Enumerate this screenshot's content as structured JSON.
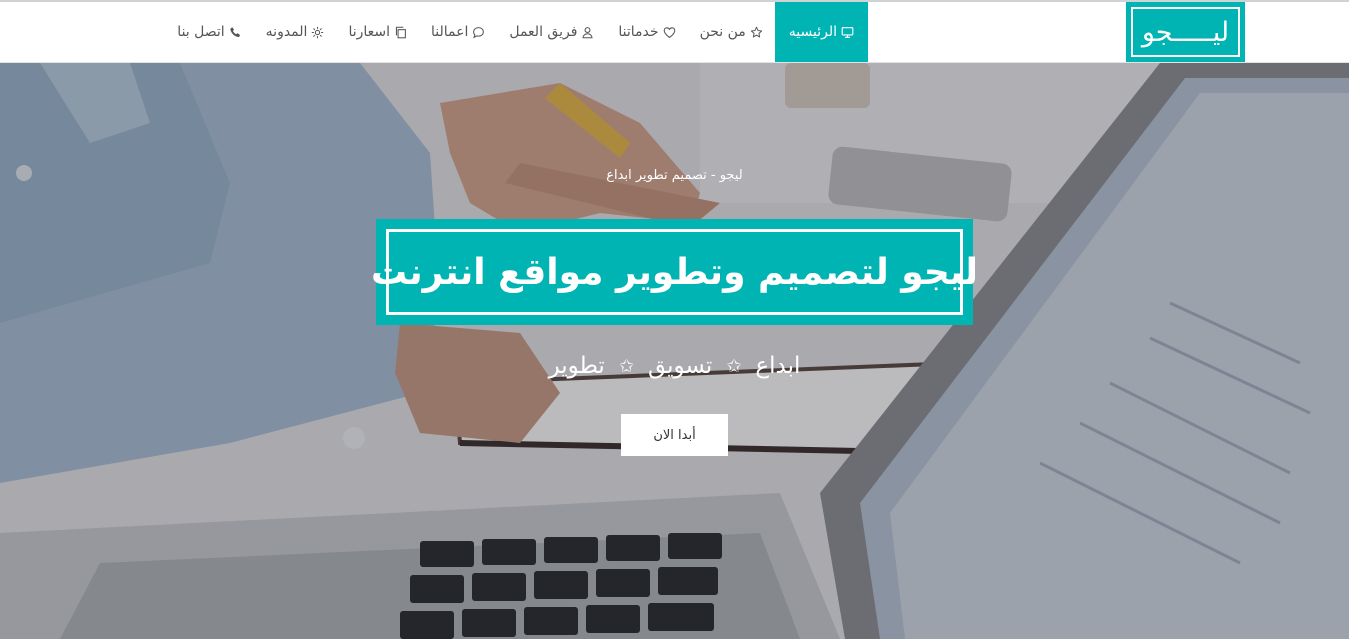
{
  "brand": {
    "logo_text": "ليـــــجو",
    "accent_color": "#00b4b4"
  },
  "nav": {
    "items": [
      {
        "label": "الرئيسيه",
        "icon": "monitor-icon",
        "active": true
      },
      {
        "label": "من نحن",
        "icon": "star-icon",
        "active": false
      },
      {
        "label": "خدماتنا",
        "icon": "heart-icon",
        "active": false
      },
      {
        "label": "فريق العمل",
        "icon": "user-icon",
        "active": false
      },
      {
        "label": "اعمالنا",
        "icon": "chat-icon",
        "active": false
      },
      {
        "label": "اسعارنا",
        "icon": "copy-icon",
        "active": false
      },
      {
        "label": "المدونه",
        "icon": "gear-icon",
        "active": false
      },
      {
        "label": "اتصل بنا",
        "icon": "phone-icon",
        "active": false
      }
    ]
  },
  "hero": {
    "tagline": "ليجو - تصميم تطوير ابداع",
    "title": "ليجو لتصميم وتطوير مواقع انترنت",
    "features": [
      "ابداع",
      "تسويق",
      "تطوير"
    ],
    "separator": "✩",
    "cta_label": "أبدا الان"
  }
}
